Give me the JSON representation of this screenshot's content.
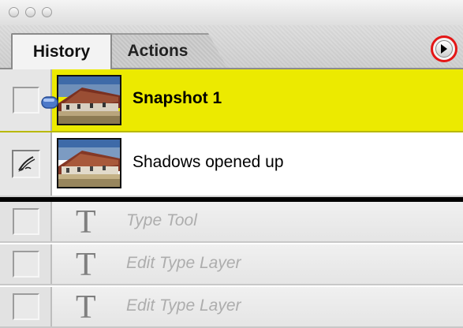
{
  "window": {
    "buttons": [
      "close",
      "minimize",
      "zoom"
    ]
  },
  "tabs": {
    "history": "History",
    "actions": "Actions"
  },
  "panel_menu_icon": "triangle-right-icon",
  "history": {
    "rows": [
      {
        "label": "Snapshot 1",
        "state": "selected",
        "has_history_brush": false
      },
      {
        "label": "Shadows opened up",
        "state": "normal",
        "has_history_brush": true
      },
      {
        "label": "Type Tool",
        "state": "dimmed",
        "icon": "type-tool-icon"
      },
      {
        "label": "Edit Type Layer",
        "state": "dimmed",
        "icon": "type-tool-icon"
      },
      {
        "label": "Edit Type Layer",
        "state": "dimmed",
        "icon": "type-tool-icon"
      }
    ],
    "tool_glyph": "T"
  },
  "colors": {
    "selected_row": "#ecea00",
    "highlight_circle": "#e41616"
  }
}
